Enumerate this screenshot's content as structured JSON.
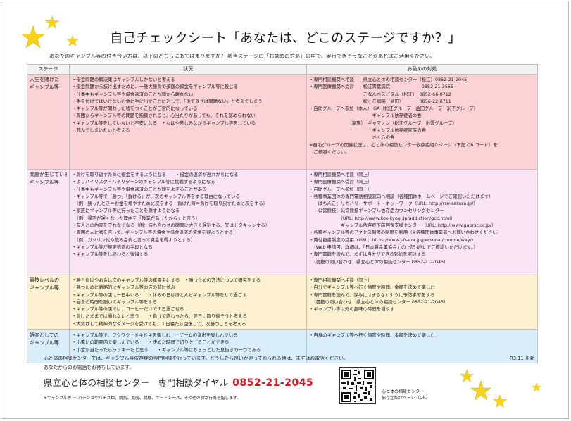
{
  "title": "自己チェックシート「あなたは、どこのステージですか？」",
  "intro": "あなたのギャンブル等の付き合い方は、以下のどちらにあてはまりますか？ 該当ステージの「お勧めの対処」の中で、実行できそうなことがあればご活用ください。",
  "table": {
    "headers": {
      "stage": "ステージ",
      "situation": "状況",
      "action": "お勧めの対処"
    },
    "rows": [
      {
        "stage": [
          "人生を賭けた",
          "ギャンブル等"
        ],
        "situation": [
          "・借金問題の解決策はギャンブルしかないと考える",
          "・借金問題から抜け出すために、一発大勝負で多額の資金をギャンブル等に投じる",
          "・仕事中もギャンブル等や借金返済のことが頭から離れない",
          "・手を付けてはいけないお金に手に出すことに対して、「後で返せば問題ない」と考えてしまう",
          "・ギャンブル等が関わった嘘をつくことが日常的になっている",
          "・周囲からギャンブル等の問題を指摘されると、心当たりがあっても、それを認められない",
          "・ギャンブル等をしていないと不安になる　・もはや苦しみながらギャンブル等をしている",
          "・死んでしまいたいと考える"
        ],
        "action": [
          "・専門相談機関へ相談　　県立心と体の相談センター（松江）0852-21-2045",
          "・専門医療機関へ受診　　松江青葉病院　　　　　　　0852-21-3565",
          "　　　　　　　　　　　　こなんホスピタル（松江）　0852-66-0712",
          "　　　　　　　　　　　　松ヶ丘病院（益田）　　　　0856-22-8711",
          "・自助グループへ参加（本人） GA（松江グループ　益田グループ　米子グループ）",
          "　　　　　　　　　　　　　　ギャンブル依存症者の会",
          "　　　　　　　　　（家族）　ギャマノン（松江グループ　出雲グループ）",
          "　　　　　　　　　　　　　　ギャンブル依存症家族の会",
          "　　　　　　　　　　　　　　さくらの会",
          "※自助グループの開催状況は、心と体の相談センター依存症紹介ページ（下記 QR コード）を",
          "　ご参照ください。"
        ]
      },
      {
        "stage": [
          "問題が生じている",
          "ギャンブル等"
        ],
        "situation": [
          "・負けを取り返すために借金をするようになる　　・借金の返済が遅れがちになる",
          "・よりハイリスク・ハイリターンのギャンブル等に挑戦するようになる",
          "・仕事中もギャンブル等や借金返済のことが頭をよぎることがある",
          "・ギャンブル等で「勝つ」「負ける」が、次のギャンブル等をする理由になっている",
          "　（例：勝ったとき＝お金を増やすために次をする　負けた時＝負けを取り戻すために次をする）",
          "・家族にギャンブル等に行ったことを隠すようになる",
          "　（例：帰宅が遅くなった理由を「残業があったから」と言う）",
          "・友人との約束を守れなくなる（例：待ち合わせの時間に大きく遅刻する、又はドタキャンする）",
          "・周囲の人に嘘を言って、ギャンブル等の資金や借金返済の資金を得ようとする",
          "　（例：ガソリン代や飲み会代と言って資金を得ようとする）",
          "・ギャンブル等が現実逃避の手段となる",
          "・ギャンブル等をし終わると後悔する"
        ],
        "action": [
          "・専門相談機関へ相談（同上）",
          "・専門医療機関へ受診（同上）",
          "・自助グループへ参加（同上）",
          "・各種事業団体の専門電話相談窓口へ相談（各種団体ホームページでご確認いただけます）",
          "　　ぱちんこ：リカバリーサポート・ネットワーク（URL: http://rsn-sakura.jp/）",
          "　　公営競技：公営競技ギャンブル依存症カウンセリングセンター",
          "　　　　　　　（URL: http://www.koeikyogi.jp/addiction/gcc.html）",
          "　　　　　　　ギャンブル依存症予防回復支援センター（URL: http://www.gaprsc.or.jp/）",
          "・各種ギャンブル等のアクセス制限の制度を利用（※各種団体事業者へお問い合わせください）",
          "・貸付自粛制度の活用（URL：https://www.j-fsa.or.jp/personal/trouble/way/）",
          "　（Web 申請可。詳細は、「日本貸金業協会」の上記 URL でご確認いただけます。）",
          "・専門書籍を読んで、まずは自分ができる対処を実践する",
          "　（書籍の問い合わせ：県立心と体の相談センター 0852-21-2045）"
        ]
      },
      {
        "stage": [
          "競技レベルの",
          "ギャンブル等"
        ],
        "situation": [
          "・勝ち負けやお金は次のギャンブル等の軍資金にする　・勝つための方法について研究をする",
          "・勝つために戦略的にギャンブル等の店の前に並ぶ",
          "・ギャンブル等の店に一日中いる　　・休みの日はほとんどギャンブル等をして過ごす",
          "・昼食の時間を割いてギャンブル等をする",
          "・ギャンブル等の店では、コーヒーだけで１日過ごせる",
          "・負けたままでは帰れないと思う　　・負けて終わったら、翌日に取り返そうと考える",
          "・大負けして精神的なダメージを受けても、１日寝たら回復して、次勝つことを考える"
        ],
        "action": [
          "・専門相談機関へ相談（同上）",
          "・自分でギャンブル等へ行く頻度や時間、金額を決めて楽しむ",
          "・専門書籍を読んで、深みにはまらないように予防学習をする",
          "　（書籍の問い合わせ：県立心と体の相談センター 0852-21-2045）",
          "・ギャンブル等以外の趣味の時間を増やす"
        ]
      },
      {
        "stage": [
          "娯楽としての",
          "ギャンブル等"
        ],
        "situation": [
          "・ギャンブル等で、ワクワク・ドキドキを楽しむ　・ゲームの演出を楽しんでいる",
          "・小遣いの範囲内で楽しんでいる　　・決めた時間で切り上げることができる",
          "・小金が当たったらラッキーだと思う　　・ギャンブル等はちょっとした息抜きの一つである"
        ],
        "action": [
          "・自身のギャンブル等へ行く頻度や時間、金額を決めて楽しむ"
        ]
      }
    ]
  },
  "footer": {
    "note_line1": "心と体の相談センターでは、ギャンブル等依存症の専門相談を行っています。どうしたら良いか迷っておられる時は、まずはお電話ください。",
    "note_line2": "あなたからのお電話をお待ちしています。",
    "date": "R3.11 更新",
    "center_name": "県立心と体の相談センター　専門相談ダイヤル",
    "center_tel": "0852-21-2045",
    "footnote": "※ギャンブル等 ＝ パチンコやパチスロ、競馬、競艇、競輪、オートレース、その他の射幸行為を指します。",
    "qr_caption_line1": "心と体の相談センター",
    "qr_caption_line2": "依存症紹介ページ（QR）"
  },
  "decor": {
    "star_color": "#f8d21b",
    "star_outline": "#e2b800"
  }
}
